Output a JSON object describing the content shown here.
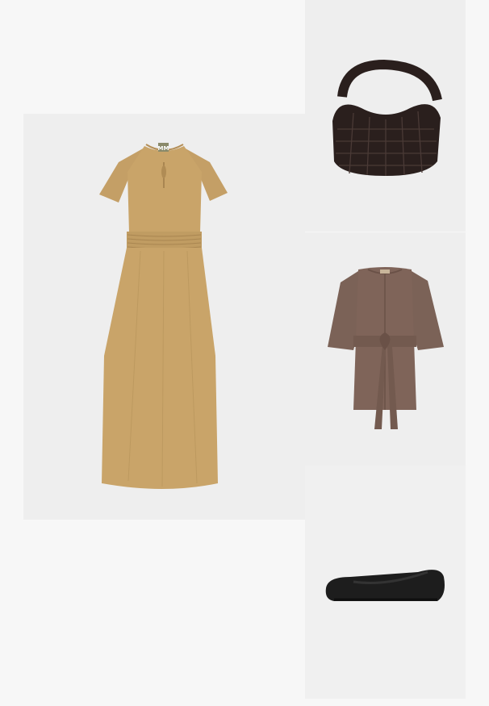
{
  "outfit": {
    "items": [
      {
        "kind": "dress",
        "color": "#c9a469",
        "label_tag": "MM"
      },
      {
        "kind": "woven-handbag",
        "color": "#2a1f1d"
      },
      {
        "kind": "belted-jacket",
        "color": "#7b6257"
      },
      {
        "kind": "ballet-flat",
        "color": "#1d1d1d"
      }
    ]
  },
  "colors": {
    "page_background": "#f7f7f7",
    "tile_background": "#eeeeee"
  }
}
